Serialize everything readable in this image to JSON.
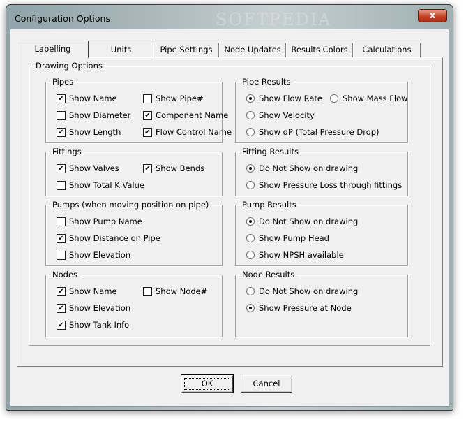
{
  "window": {
    "title": "Configuration Options",
    "close_glyph": "x",
    "watermark": "SOFTPEDIA"
  },
  "tabs": [
    "Labelling",
    "Units",
    "Pipe Settings",
    "Node Updates",
    "Results Colors",
    "Calculations"
  ],
  "drawing_options": {
    "title": "Drawing Options",
    "pipes": {
      "title": "Pipes",
      "items": [
        {
          "label": "Show Name",
          "checked": true
        },
        {
          "label": "Show Pipe#",
          "checked": false
        },
        {
          "label": "Show Diameter",
          "checked": false
        },
        {
          "label": "Component Name",
          "checked": true
        },
        {
          "label": "Show Length",
          "checked": true
        },
        {
          "label": "Flow Control Name",
          "checked": true
        }
      ]
    },
    "fittings": {
      "title": "Fittings",
      "items": [
        {
          "label": "Show Valves",
          "checked": true
        },
        {
          "label": "Show Bends",
          "checked": true
        },
        {
          "label": "Show Total K Value",
          "checked": false
        }
      ]
    },
    "pumps": {
      "title": "Pumps (when moving position on pipe)",
      "items": [
        {
          "label": "Show Pump Name",
          "checked": false
        },
        {
          "label": "Show Distance on Pipe",
          "checked": true
        },
        {
          "label": "Show Elevation",
          "checked": false
        }
      ]
    },
    "nodes": {
      "title": "Nodes",
      "items": [
        {
          "label": "Show Name",
          "checked": true
        },
        {
          "label": "Show Node#",
          "checked": false
        },
        {
          "label": "Show Elevation",
          "checked": true
        },
        {
          "label": "Show Tank Info",
          "checked": true
        }
      ]
    },
    "pipe_results": {
      "title": "Pipe Results",
      "options": [
        "Show Flow Rate",
        "Show Mass Flow",
        "Show Velocity",
        "Show dP (Total Pressure Drop)"
      ],
      "selected": "Show Flow Rate"
    },
    "fitting_results": {
      "title": "Fitting Results",
      "options": [
        "Do Not Show on drawing",
        "Show Pressure Loss through fittings"
      ],
      "selected": "Do Not Show on drawing"
    },
    "pump_results": {
      "title": "Pump Results",
      "options": [
        "Do Not Show on drawing",
        "Show Pump Head",
        "Show NPSH available"
      ],
      "selected": "Do Not Show on drawing"
    },
    "node_results": {
      "title": "Node Results",
      "options": [
        "Do Not Show on drawing",
        "Show Pressure at Node"
      ],
      "selected": "Show Pressure at Node"
    }
  },
  "buttons": {
    "ok": "OK",
    "cancel": "Cancel"
  },
  "check_glyph": "✔"
}
